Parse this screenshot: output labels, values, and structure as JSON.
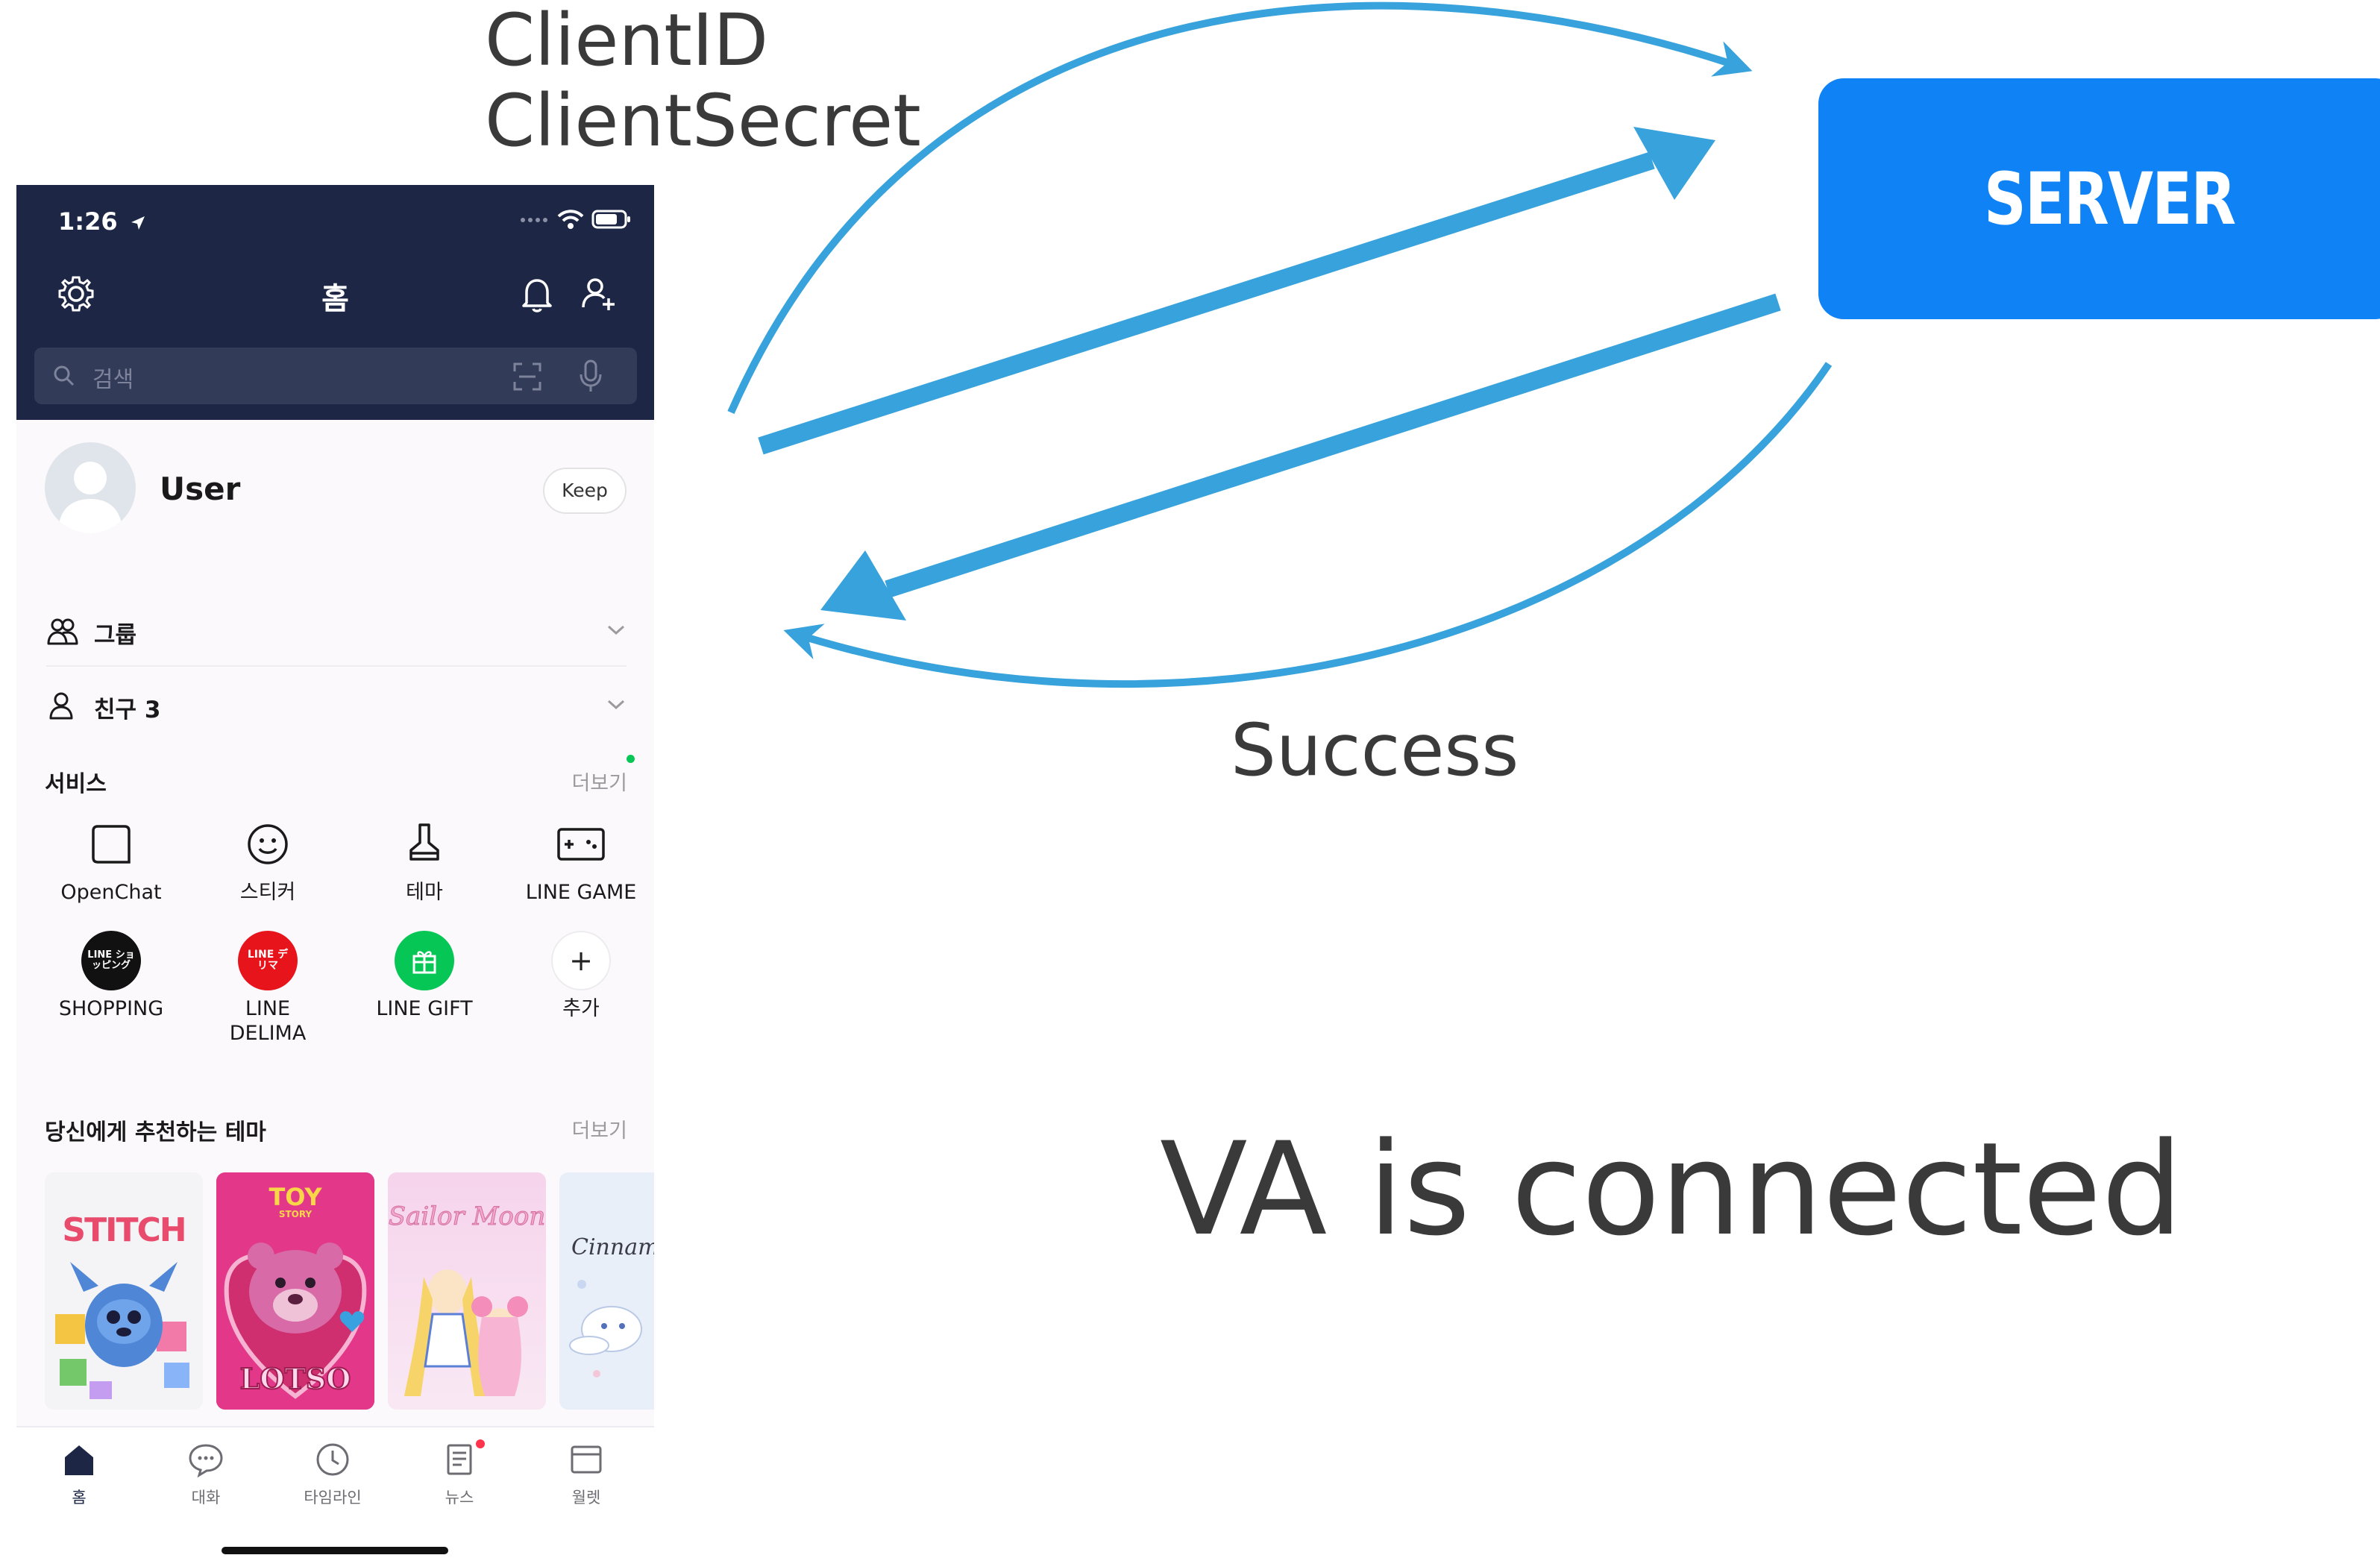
{
  "diagram": {
    "request_label_line1": "ClientID",
    "request_label_line2": "ClientSecret",
    "server_label": "SERVER",
    "response_label": "Success",
    "status_text": "VA is connected",
    "colors": {
      "arrow": "#37a2db",
      "server_box": "#0f82f5",
      "text": "#3a3a3a"
    }
  },
  "phone": {
    "status_bar": {
      "time": "1:26"
    },
    "header": {
      "title": "홈",
      "settings_icon": "gear-icon",
      "notification_icon": "bell-icon",
      "add_friend_icon": "add-friend-icon"
    },
    "search": {
      "placeholder": "검색"
    },
    "profile": {
      "name": "User",
      "keep_label": "Keep"
    },
    "lists": [
      {
        "label": "그룹",
        "icon": "group-icon"
      },
      {
        "label": "친구 3",
        "icon": "friend-icon"
      }
    ],
    "services": {
      "title": "서비스",
      "more_label": "더보기",
      "items": [
        {
          "label": "OpenChat",
          "icon": "openchat-icon"
        },
        {
          "label": "스티커",
          "icon": "sticker-icon"
        },
        {
          "label": "테마",
          "icon": "theme-icon"
        },
        {
          "label": "LINE GAME",
          "icon": "game-icon"
        },
        {
          "label": "SHOPPING",
          "icon": "shopping-icon",
          "badge_text": "LINE ショッピング",
          "color": "#111111"
        },
        {
          "label": "LINE\nDELIMA",
          "icon": "delima-icon",
          "badge_text": "LINE デリマ",
          "color": "#e8141c"
        },
        {
          "label": "LINE GIFT",
          "icon": "gift-icon",
          "color": "#06c755"
        },
        {
          "label": "추가",
          "icon": "plus-icon"
        }
      ]
    },
    "themes": {
      "title": "당신에게 추천하는 테마",
      "more_label": "더보기",
      "cards": [
        {
          "name": "STITCH",
          "icon": "stitch-theme-thumbnail"
        },
        {
          "name": "TOY STORY LOTSO",
          "icon": "lotso-theme-thumbnail"
        },
        {
          "name": "Sailor Moon",
          "icon": "sailormoon-theme-thumbnail"
        },
        {
          "name": "Cinnamoroll",
          "icon": "cinnamoroll-theme-thumbnail"
        }
      ]
    },
    "tabs": [
      {
        "label": "홈",
        "icon": "home-icon",
        "active": true
      },
      {
        "label": "대화",
        "icon": "chat-icon"
      },
      {
        "label": "타임라인",
        "icon": "clock-icon"
      },
      {
        "label": "뉴스",
        "icon": "news-icon",
        "has_dot": true
      },
      {
        "label": "월렛",
        "icon": "wallet-icon"
      }
    ]
  }
}
